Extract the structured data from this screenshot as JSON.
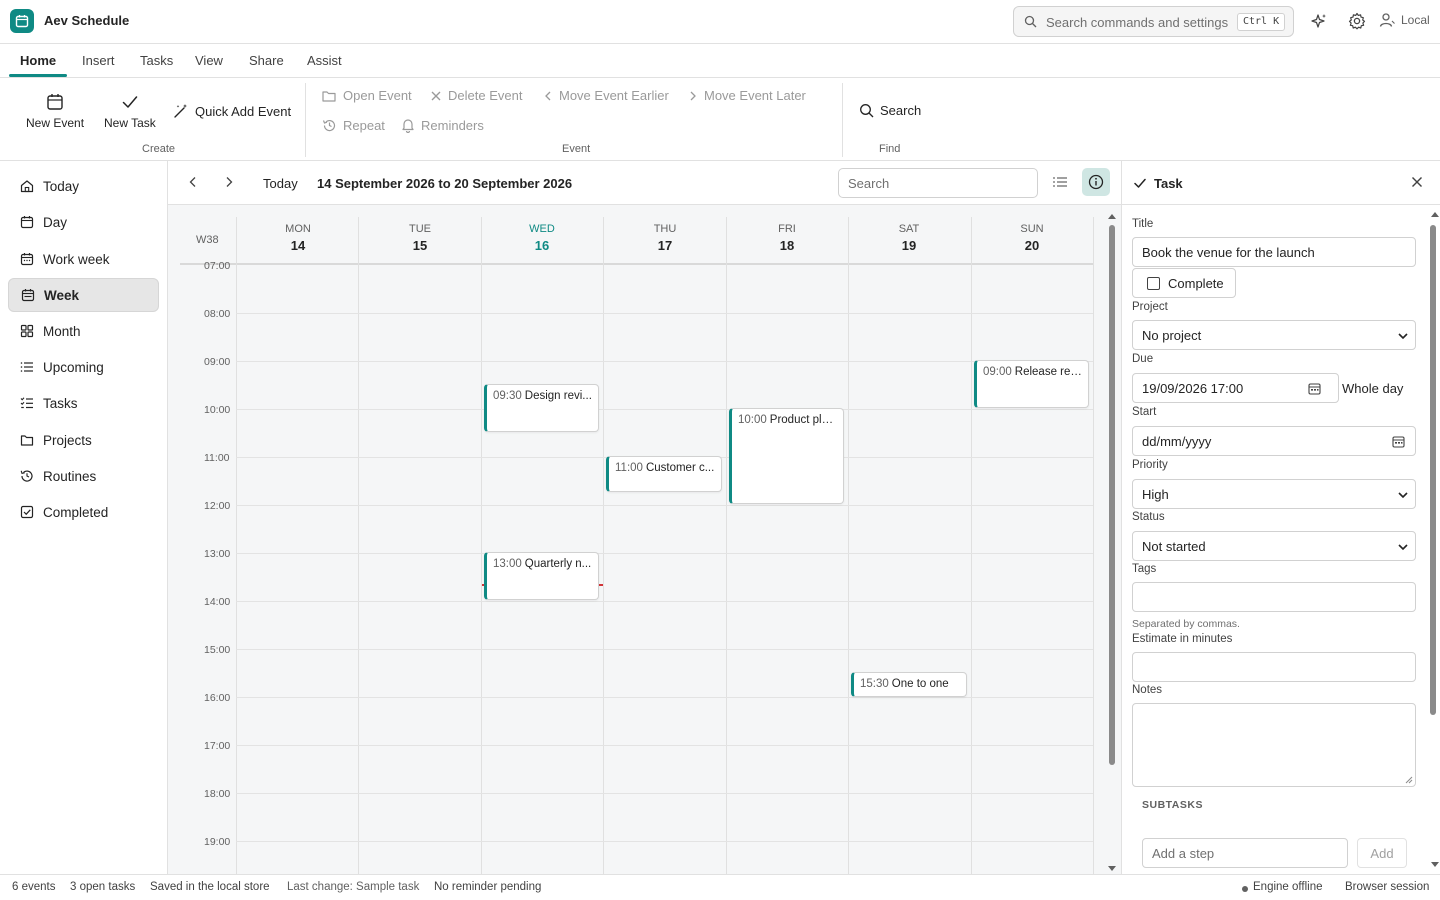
{
  "app": {
    "title": "Aev Schedule",
    "search_placeholder": "Search commands and settings",
    "search_shortcut": "Ctrl K",
    "user_label": "Local",
    "accent_color": "#0f8a84"
  },
  "ribbon_tabs": [
    "Home",
    "Insert",
    "Tasks",
    "View",
    "Share",
    "Assist"
  ],
  "ribbon": {
    "create": {
      "new_event": "New Event",
      "new_task": "New Task",
      "quick_add": "Quick Add Event",
      "label": "Create"
    },
    "event": {
      "open": "Open Event",
      "delete": "Delete Event",
      "earlier": "Move Event Earlier",
      "later": "Move Event Later",
      "repeat": "Repeat",
      "reminders": "Reminders",
      "label": "Event"
    },
    "find": {
      "search": "Search",
      "label": "Find"
    }
  },
  "sidebar": {
    "items": [
      {
        "label": "Today",
        "icon": "home-icon"
      },
      {
        "label": "Day",
        "icon": "calendar-day-icon"
      },
      {
        "label": "Work week",
        "icon": "calendar-workweek-icon"
      },
      {
        "label": "Week",
        "icon": "calendar-week-icon",
        "active": true
      },
      {
        "label": "Month",
        "icon": "grid-icon"
      },
      {
        "label": "Upcoming",
        "icon": "list-icon"
      },
      {
        "label": "Tasks",
        "icon": "task-list-icon"
      },
      {
        "label": "Projects",
        "icon": "folder-icon"
      },
      {
        "label": "Routines",
        "icon": "history-icon"
      },
      {
        "label": "Completed",
        "icon": "checkbox-icon"
      }
    ]
  },
  "calendar": {
    "today_label": "Today",
    "range_title": "14 September 2026 to 20 September 2026",
    "search_placeholder": "Search",
    "week_label": "W38",
    "days": [
      {
        "name": "MON",
        "num": "14"
      },
      {
        "name": "TUE",
        "num": "15"
      },
      {
        "name": "WED",
        "num": "16",
        "today": true
      },
      {
        "name": "THU",
        "num": "17"
      },
      {
        "name": "FRI",
        "num": "18"
      },
      {
        "name": "SAT",
        "num": "19"
      },
      {
        "name": "SUN",
        "num": "20"
      }
    ],
    "times": [
      "07:00",
      "08:00",
      "09:00",
      "10:00",
      "11:00",
      "12:00",
      "13:00",
      "14:00",
      "15:00",
      "16:00",
      "17:00",
      "18:00",
      "19:00"
    ],
    "events": [
      {
        "time": "09:30",
        "title": "Design revi..."
      },
      {
        "time": "13:00",
        "title": "Quarterly n..."
      },
      {
        "time": "11:00",
        "title": "Customer c..."
      },
      {
        "time": "10:00",
        "title": "Product pla..."
      },
      {
        "time": "15:30",
        "title": "One to one"
      },
      {
        "time": "09:00",
        "title": "Release rea..."
      }
    ]
  },
  "task_panel": {
    "heading": "Task",
    "title_label": "Title",
    "title_value": "Book the venue for the launch",
    "complete_label": "Complete",
    "project_label": "Project",
    "project_value": "No project",
    "due_label": "Due",
    "due_value": "19/09/2026 17:00",
    "whole_day": "Whole day",
    "start_label": "Start",
    "start_placeholder": "dd/mm/yyyy",
    "priority_label": "Priority",
    "priority_value": "High",
    "status_label": "Status",
    "status_value": "Not started",
    "tags_label": "Tags",
    "tags_hint": "Separated by commas.",
    "estimate_label": "Estimate in minutes",
    "notes_label": "Notes",
    "subtasks_label": "SUBTASKS",
    "add_step_placeholder": "Add a step",
    "add_button": "Add"
  },
  "status": {
    "events": "6 events",
    "tasks": "3 open tasks",
    "saved": "Saved in the local store",
    "last_change": "Last change: Sample task",
    "reminder": "No reminder pending",
    "engine": "Engine offline",
    "session": "Browser session"
  }
}
